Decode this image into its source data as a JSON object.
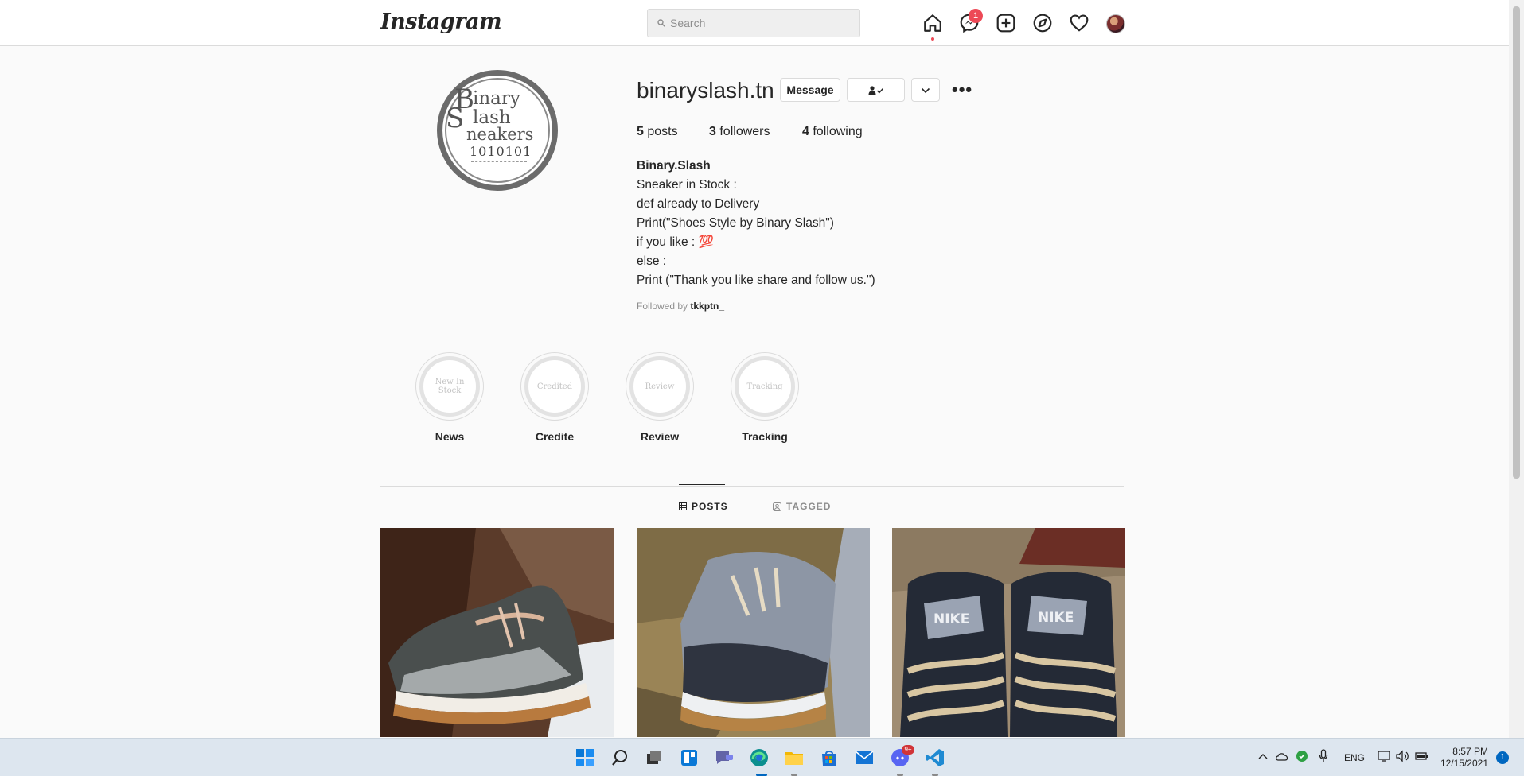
{
  "nav": {
    "logo": "Instagram",
    "search_placeholder": "Search",
    "messages_badge": "1"
  },
  "profile": {
    "username": "binaryslash.tn",
    "message_button": "Message",
    "avatar_lines": [
      "B",
      "inary",
      "S",
      "lash",
      "neakers",
      "1010101"
    ],
    "stats": {
      "posts_count": "5",
      "posts_label": "posts",
      "followers_count": "3",
      "followers_label": "followers",
      "following_count": "4",
      "following_label": "following"
    },
    "bio_name": "Binary.Slash",
    "bio_lines": [
      "Sneaker in Stock :",
      "def already to Delivery",
      "Print(\"Shoes Style by Binary Slash\")",
      "if you like : 💯",
      "else :",
      "Print (\"Thank you like share and follow us.\")"
    ],
    "followed_by_prefix": "Followed by",
    "followed_by_user": "tkkptn_"
  },
  "highlights": [
    {
      "label": "News",
      "cover_text": "New In Stock"
    },
    {
      "label": "Credite",
      "cover_text": "Credited"
    },
    {
      "label": "Review",
      "cover_text": "Review"
    },
    {
      "label": "Tracking",
      "cover_text": "Tracking"
    }
  ],
  "tabs": [
    {
      "label": "POSTS",
      "active": true,
      "icon": "grid-icon"
    },
    {
      "label": "TAGGED",
      "active": false,
      "icon": "tag-icon"
    }
  ],
  "posts": [
    {
      "subject": "grey dunk sneaker on tree bark",
      "icon": "sneaker-photo"
    },
    {
      "subject": "dark grey high-top sneaker on straw",
      "icon": "sneaker-photo"
    },
    {
      "subject": "pair of navy Nike Zoom sneakers top view",
      "icon": "sneaker-photo",
      "tongue_text": "NIKE"
    }
  ],
  "taskbar": {
    "discord_badge": "9+",
    "language": "ENG",
    "time": "8:57 PM",
    "date": "12/15/2021",
    "notification_count": "1"
  },
  "colors": {
    "badge": "#ed4956",
    "border": "#dbdbdb",
    "text": "#262626",
    "muted": "#8e8e8e",
    "taskbar": "#dde6ef"
  }
}
